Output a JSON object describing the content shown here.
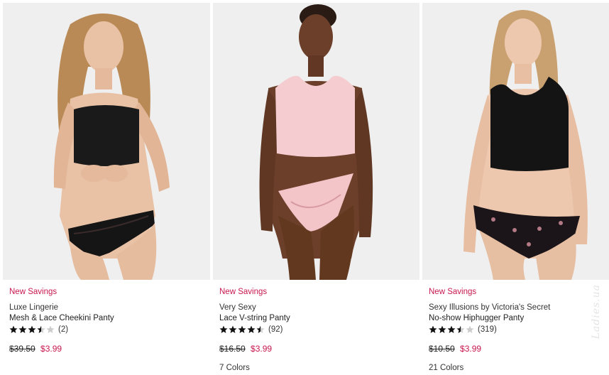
{
  "watermark": "Ladies.ua",
  "products": [
    {
      "promo": "New Savings",
      "brand": "Luxe Lingerie",
      "name": "Mesh & Lace Cheekini Panty",
      "rating": 3.5,
      "reviews": "(2)",
      "was_price": "$39.50",
      "now_price": "$3.99",
      "colors": "",
      "image": "model-black-lace-panty"
    },
    {
      "promo": "New Savings",
      "brand": "Very Sexy",
      "name": "Lace V-string Panty",
      "rating": 4.5,
      "reviews": "(92)",
      "was_price": "$16.50",
      "now_price": "$3.99",
      "colors": "7 Colors",
      "image": "model-pink-lace-vstring"
    },
    {
      "promo": "New Savings",
      "brand": "Sexy Illusions by Victoria's Secret",
      "name": "No-show Hiphugger Panty",
      "rating": 3.5,
      "reviews": "(319)",
      "was_price": "$10.50",
      "now_price": "$3.99",
      "colors": "21 Colors",
      "image": "model-black-floral-hiphugger"
    }
  ],
  "colors_map": {
    "promo": "#c8174f",
    "star_filled": "#111111",
    "star_empty": "#cccccc"
  }
}
